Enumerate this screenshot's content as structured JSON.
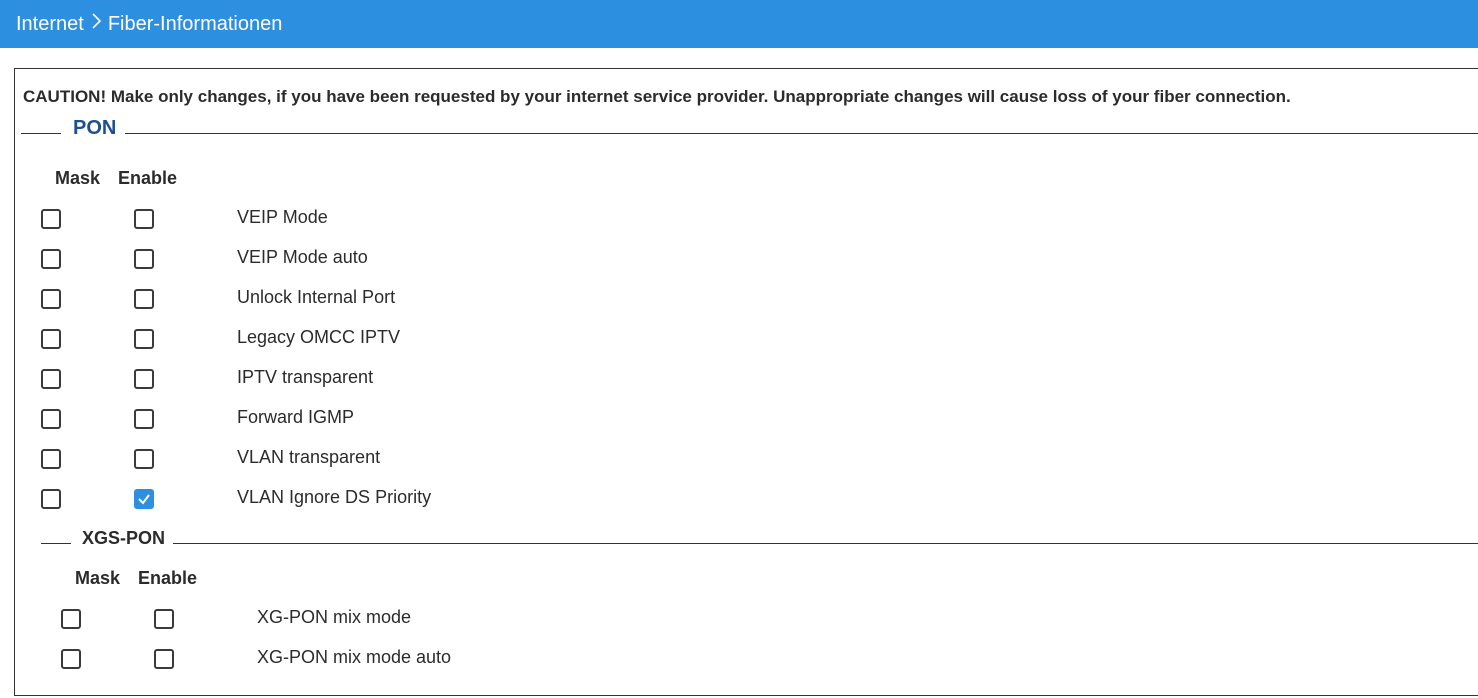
{
  "breadcrumb": {
    "parent": "Internet",
    "separator": ">",
    "current": "Fiber-Informationen"
  },
  "caution": "CAUTION! Make only changes, if you have been requested by your internet service provider. Unappropriate changes will cause loss of your fiber connection.",
  "pon": {
    "title": "PON",
    "col_mask": "Mask",
    "col_enable": "Enable",
    "options": [
      {
        "label": "VEIP Mode",
        "mask": false,
        "enable": false
      },
      {
        "label": "VEIP Mode auto",
        "mask": false,
        "enable": false
      },
      {
        "label": "Unlock Internal Port",
        "mask": false,
        "enable": false
      },
      {
        "label": "Legacy OMCC IPTV",
        "mask": false,
        "enable": false
      },
      {
        "label": "IPTV transparent",
        "mask": false,
        "enable": false
      },
      {
        "label": "Forward IGMP",
        "mask": false,
        "enable": false
      },
      {
        "label": "VLAN transparent",
        "mask": false,
        "enable": false
      },
      {
        "label": "VLAN Ignore DS Priority",
        "mask": false,
        "enable": true
      }
    ]
  },
  "xgs_pon": {
    "title": "XGS-PON",
    "col_mask": "Mask",
    "col_enable": "Enable",
    "options": [
      {
        "label": "XG-PON mix mode",
        "mask": false,
        "enable": false
      },
      {
        "label": "XG-PON mix mode auto",
        "mask": false,
        "enable": false
      }
    ]
  },
  "colors": {
    "header_bg": "#2d8fe0",
    "section_title": "#1d4f91",
    "checkbox_checked": "#2d8fe0"
  }
}
